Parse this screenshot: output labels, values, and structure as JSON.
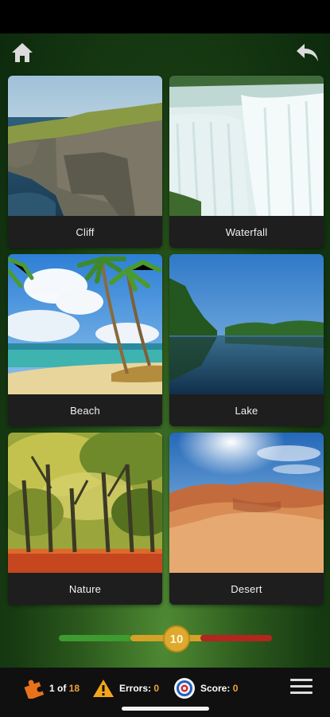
{
  "header": {
    "home_icon": "home-icon",
    "back_icon": "undo-arrow-icon"
  },
  "categories": [
    {
      "label": "Cliff"
    },
    {
      "label": "Waterfall"
    },
    {
      "label": "Beach"
    },
    {
      "label": "Lake"
    },
    {
      "label": "Nature"
    },
    {
      "label": "Desert"
    }
  ],
  "difficulty": {
    "value": "10",
    "colors": {
      "low": "#3e9b2f",
      "mid": "#d3a227",
      "high": "#b3261e",
      "knob": "#ddaa2f"
    }
  },
  "footer": {
    "progress_prefix": "1 of ",
    "progress_total": "18",
    "errors_label": "Errors: ",
    "errors_value": "0",
    "score_label": "Score: ",
    "score_value": "0",
    "accent_color": "#f3a23c"
  }
}
